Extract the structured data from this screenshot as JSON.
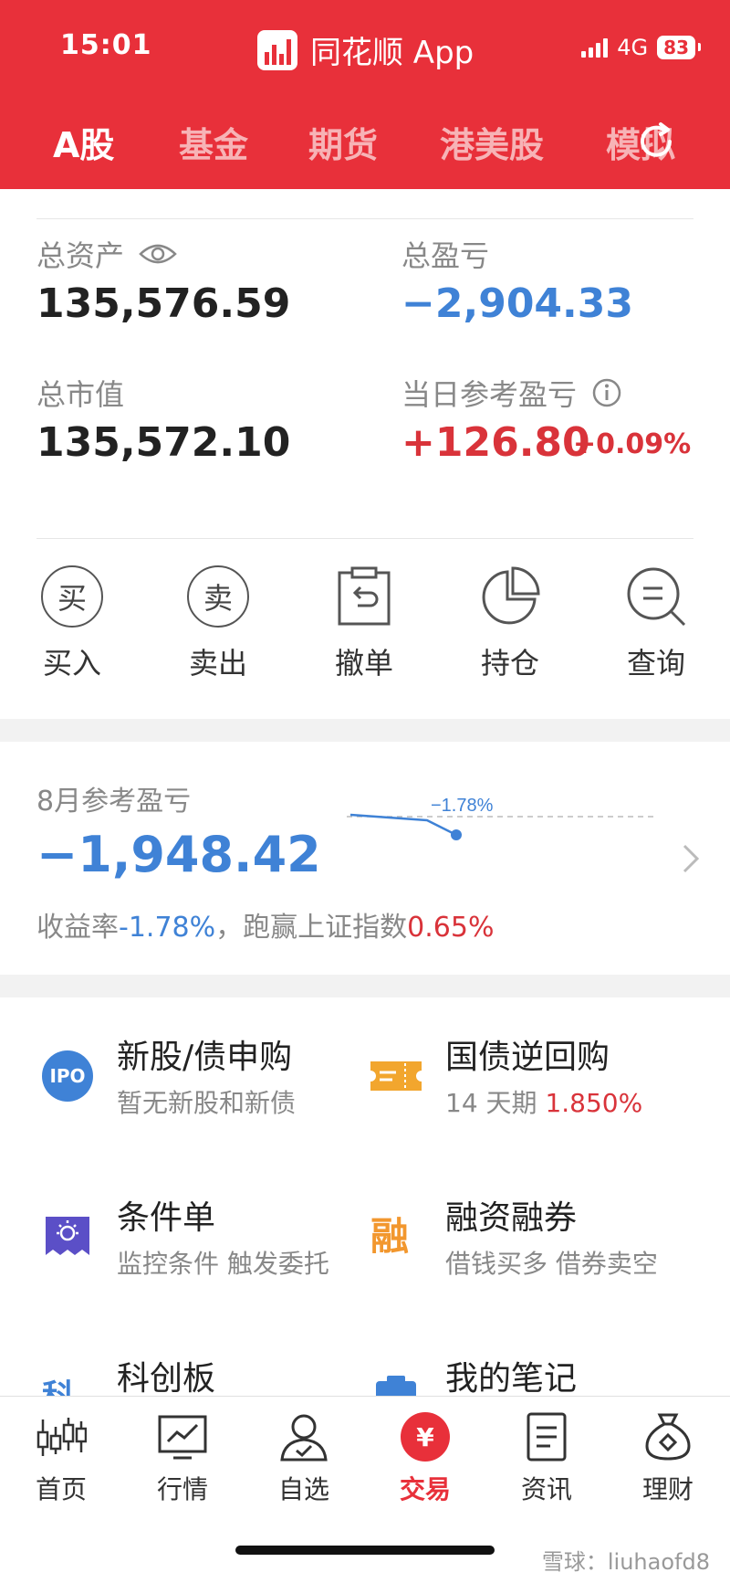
{
  "status_bar": {
    "time": "15:01",
    "network": "4G",
    "battery": "83"
  },
  "app": {
    "title": "同花顺 App"
  },
  "tabs": [
    {
      "label": "A股",
      "active": true
    },
    {
      "label": "基金",
      "active": false
    },
    {
      "label": "期货",
      "active": false
    },
    {
      "label": "港美股",
      "active": false
    },
    {
      "label": "模拟",
      "active": false
    }
  ],
  "assets": {
    "total_assets_label": "总资产",
    "total_assets": "135,576.59",
    "total_pnl_label": "总盈亏",
    "total_pnl": "−2,904.33",
    "market_value_label": "总市值",
    "market_value": "135,572.10",
    "daily_pnl_label": "当日参考盈亏",
    "daily_pnl": "+126.80",
    "daily_pnl_pct": "+0.09%"
  },
  "actions": [
    {
      "label": "买入",
      "glyph": "买",
      "icon": "buy-icon"
    },
    {
      "label": "卖出",
      "glyph": "卖",
      "icon": "sell-icon"
    },
    {
      "label": "撤单",
      "icon": "cancel-order-icon"
    },
    {
      "label": "持仓",
      "icon": "holdings-pie-icon"
    },
    {
      "label": "查询",
      "icon": "query-search-icon"
    }
  ],
  "monthly": {
    "label": "8月参考盈亏",
    "value": "−1,948.42",
    "yield_prefix": "收益率",
    "yield": "-1.78%",
    "compare_prefix": "，跑赢上证指数",
    "compare": "0.65%",
    "spark_point_label": "−1.78%"
  },
  "services": [
    {
      "title": "新股/债申购",
      "subtitle": "暂无新股和新债",
      "icon": "ipo-icon",
      "icon_text": "IPO"
    },
    {
      "title": "国债逆回购",
      "subtitle_prefix": "14 天期",
      "subtitle_value": "1.850%",
      "icon": "ticket-icon"
    },
    {
      "title": "条件单",
      "subtitle": "监控条件 触发委托",
      "icon": "condition-order-icon"
    },
    {
      "title": "融资融券",
      "subtitle": "借钱买多 借券卖空",
      "icon": "margin-icon",
      "icon_text": "融"
    },
    {
      "title": "科创板",
      "subtitle": "",
      "icon": "star-market-icon",
      "icon_text": "科"
    },
    {
      "title": "我的笔记",
      "subtitle": "",
      "icon": "notes-icon"
    }
  ],
  "bottom_nav": [
    {
      "label": "首页",
      "icon": "home-candlestick-icon"
    },
    {
      "label": "行情",
      "icon": "market-chart-icon"
    },
    {
      "label": "自选",
      "icon": "watchlist-person-icon"
    },
    {
      "label": "交易",
      "icon": "trade-yuan-icon",
      "glyph": "¥",
      "active": true
    },
    {
      "label": "资讯",
      "icon": "news-doc-icon"
    },
    {
      "label": "理财",
      "icon": "wealth-bag-icon"
    }
  ],
  "watermark": "雪球：liuhaofd8",
  "colors": {
    "brand_red": "#e8303a",
    "loss_blue": "#3f82d6",
    "gain_red": "#d9333a"
  }
}
